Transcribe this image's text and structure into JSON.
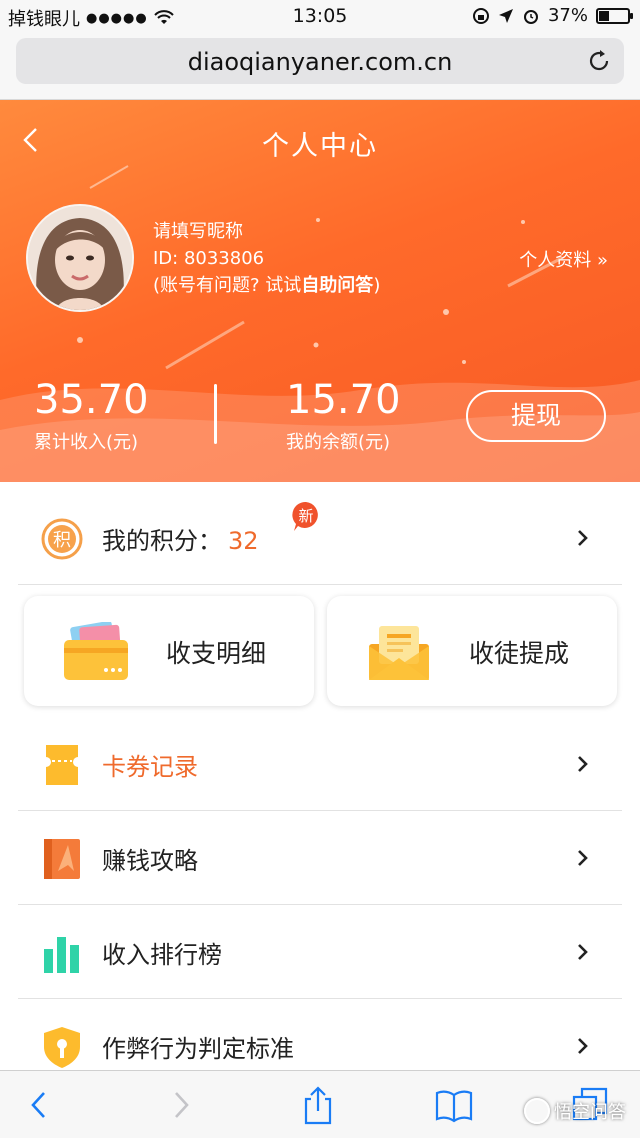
{
  "status_bar": {
    "carrier": "掉钱眼儿",
    "signal_dots": "●●●●●",
    "time": "13:05",
    "battery_percent": "37%",
    "battery_level": 0.37
  },
  "browser": {
    "url": "diaoqianyaner.com.cn"
  },
  "header": {
    "title": "个人中心",
    "nickname": "请填写昵称",
    "user_id": "ID: 8033806",
    "help_prefix": "(账号有问题? 试试",
    "help_link": "自助问答",
    "help_suffix": ")",
    "profile_link": "个人资料 »",
    "total_income_value": "35.70",
    "total_income_label": "累计收入(元)",
    "balance_value": "15.70",
    "balance_label": "我的余额(元)",
    "withdraw_label": "提现"
  },
  "points": {
    "label": "我的积分：",
    "value": "32",
    "icon_text": "积",
    "badge_text": "新"
  },
  "cards": [
    {
      "label": "收支明细",
      "icon": "card-wallet-icon"
    },
    {
      "label": "收徒提成",
      "icon": "envelope-icon"
    }
  ],
  "menu": [
    {
      "label": "卡券记录",
      "icon": "ticket-icon",
      "highlight": true
    },
    {
      "label": "赚钱攻略",
      "icon": "guide-book-icon",
      "highlight": false
    },
    {
      "label": "收入排行榜",
      "icon": "bar-chart-icon",
      "highlight": false
    },
    {
      "label": "作弊行为判定标准",
      "icon": "shield-icon",
      "highlight": false
    }
  ],
  "watermark": "悟空问答",
  "colors": {
    "accent": "#ef6a2c",
    "header_start": "#ff8a3d",
    "header_end": "#f75a25",
    "chart_green": "#2fd3a8",
    "card_yellow": "#fdc23a"
  }
}
